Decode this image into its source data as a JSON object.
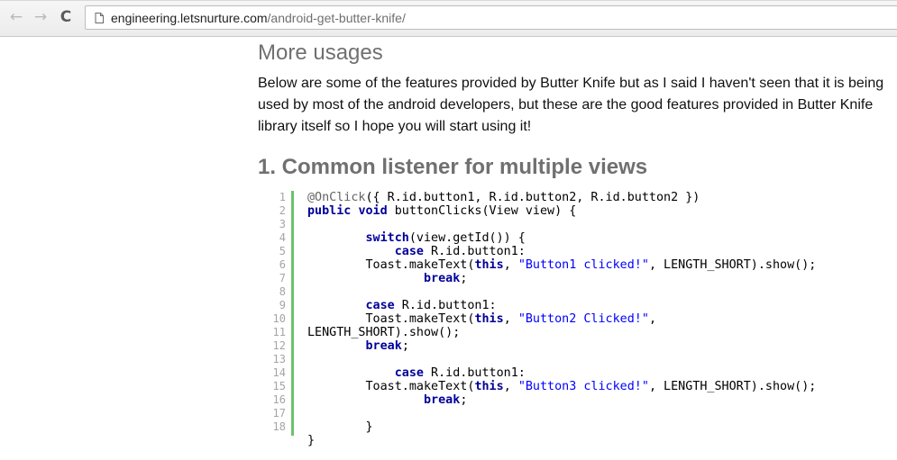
{
  "browser": {
    "back_icon": "←",
    "forward_icon": "→",
    "reload_icon": "C",
    "url_domain": "engineering.letsnurture.com",
    "url_path": "/android-get-butter-knife/"
  },
  "article": {
    "section_heading": "More usages",
    "paragraph": "Below are some of the features provided by Butter Knife but as I said I haven't seen that it is being used by most of the android developers, but these are the good features provided in Butter Knife library itself so I hope you will start using it!",
    "subheading": "1. Common listener for multiple views"
  },
  "code": {
    "line_numbers": [
      "1",
      "2",
      "3",
      "4",
      "5",
      "6",
      "7",
      "8",
      "9",
      "10",
      "11",
      "12",
      "13",
      "14",
      "15",
      "16",
      "17",
      "18"
    ],
    "lines": [
      [
        {
          "t": "ann",
          "v": "@OnClick"
        },
        {
          "t": "",
          "v": "({ R.id.button1, R.id.button2, R.id.button2 })"
        }
      ],
      [
        {
          "t": "kw",
          "v": "public"
        },
        {
          "t": "",
          "v": " "
        },
        {
          "t": "kw",
          "v": "void"
        },
        {
          "t": "",
          "v": " buttonClicks(View view) {"
        }
      ],
      [],
      [
        {
          "t": "",
          "v": "        "
        },
        {
          "t": "kw",
          "v": "switch"
        },
        {
          "t": "",
          "v": "(view.getId()) {"
        }
      ],
      [
        {
          "t": "",
          "v": "            "
        },
        {
          "t": "kw",
          "v": "case"
        },
        {
          "t": "",
          "v": " R.id.button1:"
        }
      ],
      [
        {
          "t": "",
          "v": "        Toast.makeText("
        },
        {
          "t": "kw",
          "v": "this"
        },
        {
          "t": "",
          "v": ", "
        },
        {
          "t": "str",
          "v": "\"Button1 clicked!\""
        },
        {
          "t": "",
          "v": ", LENGTH_SHORT).show();"
        }
      ],
      [
        {
          "t": "",
          "v": "                "
        },
        {
          "t": "kw",
          "v": "break"
        },
        {
          "t": "",
          "v": ";"
        }
      ],
      [],
      [
        {
          "t": "",
          "v": "        "
        },
        {
          "t": "kw",
          "v": "case"
        },
        {
          "t": "",
          "v": " R.id.button1:"
        }
      ],
      [
        {
          "t": "",
          "v": "        Toast.makeText("
        },
        {
          "t": "kw",
          "v": "this"
        },
        {
          "t": "",
          "v": ", "
        },
        {
          "t": "str",
          "v": "\"Button2 Clicked!\""
        },
        {
          "t": "",
          "v": ","
        }
      ],
      [
        {
          "t": "",
          "v": "LENGTH_SHORT).show();"
        }
      ],
      [
        {
          "t": "",
          "v": "        "
        },
        {
          "t": "kw",
          "v": "break"
        },
        {
          "t": "",
          "v": ";"
        }
      ],
      [],
      [
        {
          "t": "",
          "v": "            "
        },
        {
          "t": "kw",
          "v": "case"
        },
        {
          "t": "",
          "v": " R.id.button1:"
        }
      ],
      [
        {
          "t": "",
          "v": "        Toast.makeText("
        },
        {
          "t": "kw",
          "v": "this"
        },
        {
          "t": "",
          "v": ", "
        },
        {
          "t": "str",
          "v": "\"Button3 clicked!\""
        },
        {
          "t": "",
          "v": ", LENGTH_SHORT).show();"
        }
      ],
      [
        {
          "t": "",
          "v": "                "
        },
        {
          "t": "kw",
          "v": "break"
        },
        {
          "t": "",
          "v": ";"
        }
      ],
      [],
      [
        {
          "t": "",
          "v": "        }"
        }
      ],
      [
        {
          "t": "",
          "v": "}"
        }
      ]
    ]
  },
  "colors": {
    "heading": "#707070",
    "keyword": "#000099",
    "string": "#0000ff",
    "annotation": "#646464",
    "gutter_bar": "#6ac36a"
  }
}
